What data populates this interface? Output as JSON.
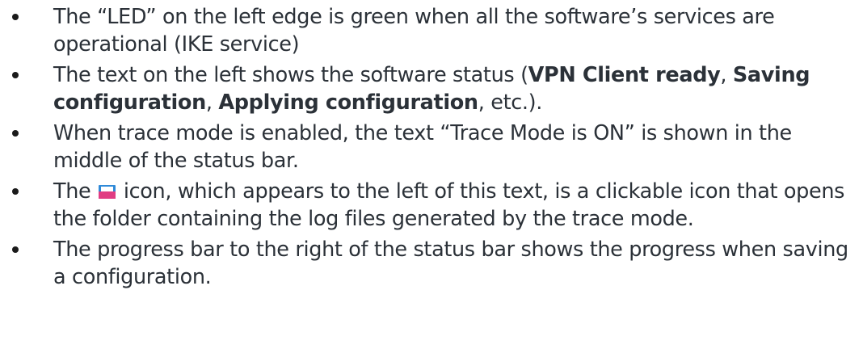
{
  "bullets": [
    {
      "t1": "The “LED” on the left edge is green when all the software’s services are operational (IKE service)"
    },
    {
      "t1": "The text on the left shows the software status (",
      "b1": "VPN Client ready",
      "t2": ", ",
      "b2": "Saving configuration",
      "t3": ", ",
      "b3": "Applying configuration",
      "t4": ", etc.)."
    },
    {
      "t1": "When trace mode is enabled, the text “Trace Mode is ON” is shown in the middle of the status bar."
    },
    {
      "t1": "The ",
      "icon": "folder-icon",
      "t2": " icon, which appears to the left of this text, is a clickable icon that opens the folder containing the log files generated by the trace mode."
    },
    {
      "t1": "The progress bar to the right of the status bar shows the progress when saving a configuration."
    }
  ]
}
